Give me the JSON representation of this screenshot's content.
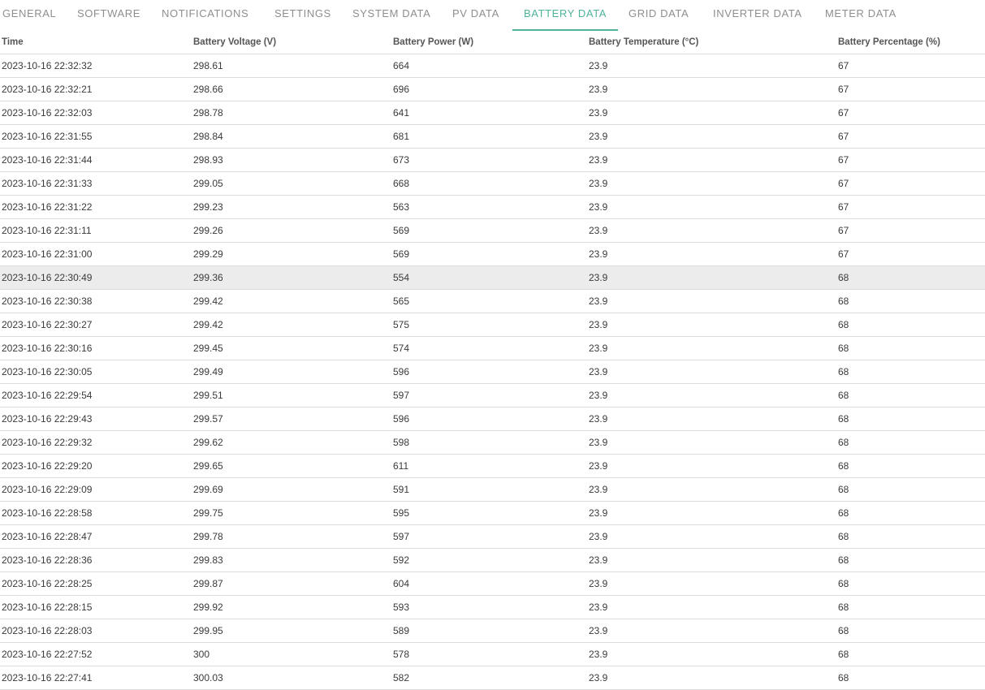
{
  "tabs": [
    "GENERAL",
    "SOFTWARE",
    "NOTIFICATIONS",
    "SETTINGS",
    "SYSTEM DATA",
    "PV DATA",
    "BATTERY DATA",
    "GRID DATA",
    "INVERTER DATA",
    "METER DATA"
  ],
  "active_tab": "BATTERY DATA",
  "table": {
    "headers": [
      "Time",
      "Battery Voltage (V)",
      "Battery Power (W)",
      "Battery Temperature (°C)",
      "Battery Percentage (%)"
    ],
    "rows": [
      [
        "2023-10-16 22:32:32",
        "298.61",
        "664",
        "23.9",
        "67"
      ],
      [
        "2023-10-16 22:32:21",
        "298.66",
        "696",
        "23.9",
        "67"
      ],
      [
        "2023-10-16 22:32:03",
        "298.78",
        "641",
        "23.9",
        "67"
      ],
      [
        "2023-10-16 22:31:55",
        "298.84",
        "681",
        "23.9",
        "67"
      ],
      [
        "2023-10-16 22:31:44",
        "298.93",
        "673",
        "23.9",
        "67"
      ],
      [
        "2023-10-16 22:31:33",
        "299.05",
        "668",
        "23.9",
        "67"
      ],
      [
        "2023-10-16 22:31:22",
        "299.23",
        "563",
        "23.9",
        "67"
      ],
      [
        "2023-10-16 22:31:11",
        "299.26",
        "569",
        "23.9",
        "67"
      ],
      [
        "2023-10-16 22:31:00",
        "299.29",
        "569",
        "23.9",
        "67"
      ],
      [
        "2023-10-16 22:30:49",
        "299.36",
        "554",
        "23.9",
        "68"
      ],
      [
        "2023-10-16 22:30:38",
        "299.42",
        "565",
        "23.9",
        "68"
      ],
      [
        "2023-10-16 22:30:27",
        "299.42",
        "575",
        "23.9",
        "68"
      ],
      [
        "2023-10-16 22:30:16",
        "299.45",
        "574",
        "23.9",
        "68"
      ],
      [
        "2023-10-16 22:30:05",
        "299.49",
        "596",
        "23.9",
        "68"
      ],
      [
        "2023-10-16 22:29:54",
        "299.51",
        "597",
        "23.9",
        "68"
      ],
      [
        "2023-10-16 22:29:43",
        "299.57",
        "596",
        "23.9",
        "68"
      ],
      [
        "2023-10-16 22:29:32",
        "299.62",
        "598",
        "23.9",
        "68"
      ],
      [
        "2023-10-16 22:29:20",
        "299.65",
        "611",
        "23.9",
        "68"
      ],
      [
        "2023-10-16 22:29:09",
        "299.69",
        "591",
        "23.9",
        "68"
      ],
      [
        "2023-10-16 22:28:58",
        "299.75",
        "595",
        "23.9",
        "68"
      ],
      [
        "2023-10-16 22:28:47",
        "299.78",
        "597",
        "23.9",
        "68"
      ],
      [
        "2023-10-16 22:28:36",
        "299.83",
        "592",
        "23.9",
        "68"
      ],
      [
        "2023-10-16 22:28:25",
        "299.87",
        "604",
        "23.9",
        "68"
      ],
      [
        "2023-10-16 22:28:15",
        "299.92",
        "593",
        "23.9",
        "68"
      ],
      [
        "2023-10-16 22:28:03",
        "299.95",
        "589",
        "23.9",
        "68"
      ],
      [
        "2023-10-16 22:27:52",
        "300",
        "578",
        "23.9",
        "68"
      ],
      [
        "2023-10-16 22:27:41",
        "300.03",
        "582",
        "23.9",
        "68"
      ]
    ]
  },
  "colors": {
    "accent": "#4db39a",
    "row_highlight": "#ececec"
  }
}
